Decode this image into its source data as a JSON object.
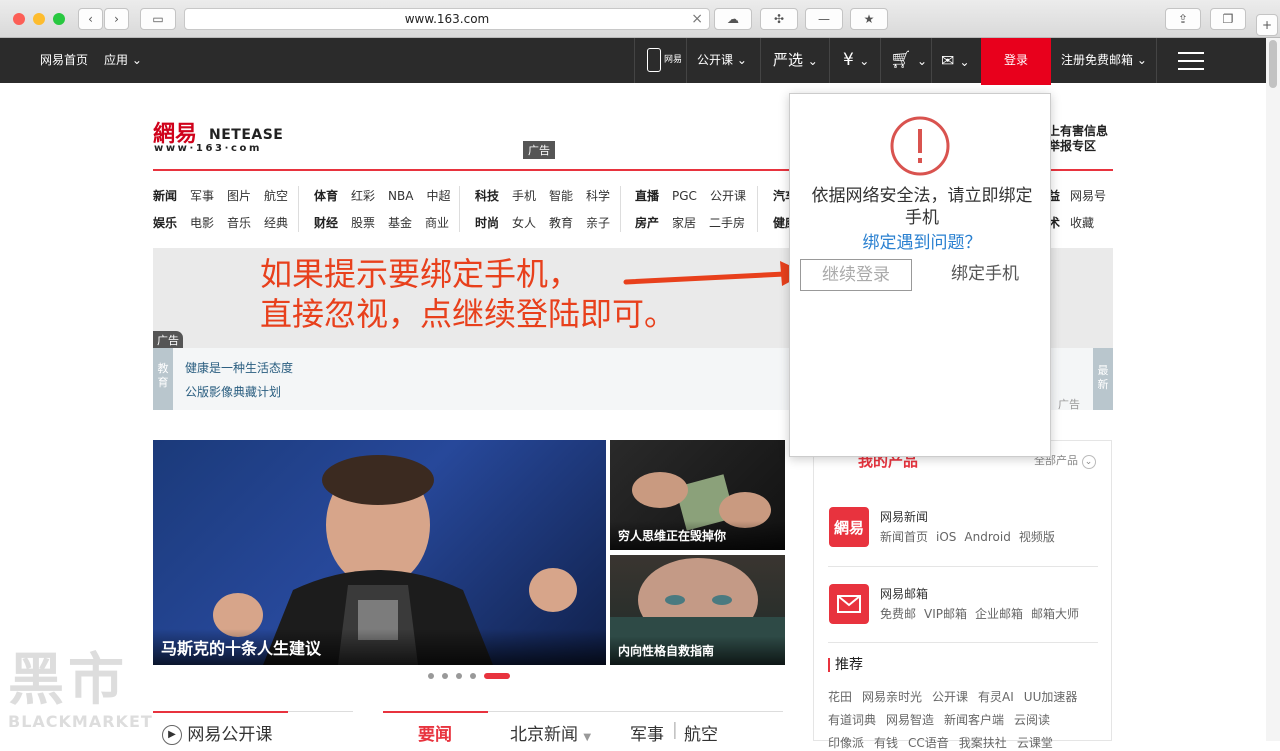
{
  "browser": {
    "url": "www.163.com"
  },
  "topnav": {
    "home": "网易首页",
    "apps": "应用",
    "mobile_label": "网易",
    "open_course": "公开课",
    "yanxuan": "严选",
    "yuan": "¥",
    "login": "登录",
    "register": "注册免费邮箱"
  },
  "header": {
    "logo_cn": "網易",
    "logo_en": "NETEASE",
    "logo_url": "www·163·com",
    "ad_tag": "广告",
    "right_line1": "上有害信息",
    "right_line2": "举报专区"
  },
  "channels": {
    "row1": {
      "g1": [
        "新闻",
        "军事",
        "图片",
        "航空"
      ],
      "g2": [
        "体育",
        "红彩",
        "NBA",
        "中超"
      ],
      "g3": [
        "科技",
        "手机",
        "智能",
        "科学"
      ],
      "g4": [
        "直播",
        "PGC",
        "公开课"
      ],
      "g5": [
        "汽车"
      ],
      "g6": [
        "益",
        "网易号"
      ]
    },
    "row2": {
      "g1": [
        "娱乐",
        "电影",
        "音乐",
        "经典"
      ],
      "g2": [
        "财经",
        "股票",
        "基金",
        "商业"
      ],
      "g3": [
        "时尚",
        "女人",
        "教育",
        "亲子"
      ],
      "g4": [
        "房产",
        "家居",
        "二手房"
      ],
      "g5": [
        "健康"
      ],
      "g6": [
        "术",
        "收藏"
      ]
    }
  },
  "annotation": {
    "line1": "如果提示要绑定手机，",
    "line2": "直接忽视，点继续登陆即可。"
  },
  "edu_bar": {
    "ad_tag": "广告",
    "tag": "教育",
    "link1": "健康是一种生活态度",
    "link2": "公版影像典藏计划",
    "new_tag": "最新",
    "ad_small": "广告"
  },
  "news": {
    "main_caption": "马斯克的十条人生建议",
    "side1_caption": "穷人思维正在毁掉你",
    "side2_caption": "内向性格自救指南"
  },
  "products": {
    "tab_label": "我的产品",
    "all_label": "全部产品",
    "news_title": "网易新闻",
    "news_icon": "網易",
    "news_links": [
      "新闻首页",
      "iOS",
      "Android",
      "视频版"
    ],
    "mail_title": "网易邮箱",
    "mail_links": [
      "免费邮",
      "VIP邮箱",
      "企业邮箱",
      "邮箱大师"
    ],
    "rec_title": "推荐",
    "rec_row1": [
      "花田",
      "网易亲时光",
      "公开课",
      "有灵AI",
      "UU加速器"
    ],
    "rec_row2": [
      "有道词典",
      "网易智造",
      "新闻客户端",
      "云阅读"
    ],
    "rec_row3": [
      "印像派",
      "有钱",
      "CC语音",
      "我案扶社",
      "云课堂"
    ]
  },
  "bottom_tabs": {
    "open_course": "网易公开课",
    "yaowen": "要闻",
    "beijing": "北京新闻",
    "military": "军事",
    "aviation": "航空"
  },
  "modal": {
    "message": "依据网络安全法，请立即绑定手机",
    "help": "绑定遇到问题？",
    "continue": "继续登录",
    "bind": "绑定手机"
  },
  "watermark": {
    "cn": "黑市",
    "en": "BLACKMARKET"
  },
  "colors": {
    "accent_red": "#e8333e",
    "nav_bg": "#2b2b2b",
    "annotation": "#e8401c",
    "link_blue": "#2a80d0"
  }
}
